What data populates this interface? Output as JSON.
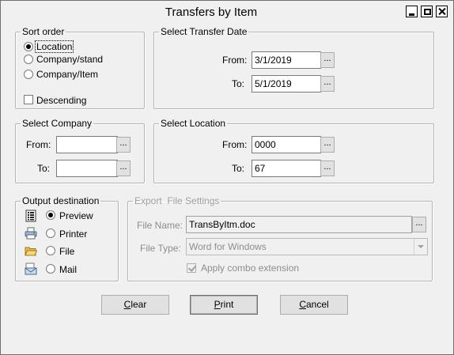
{
  "window": {
    "title": "Transfers by Item",
    "controls": {
      "minimize": "minimize-icon",
      "maximize": "maximize-icon",
      "close": "close-icon"
    }
  },
  "sort_order": {
    "legend": "Sort order",
    "options": [
      {
        "label": "Location",
        "checked": true
      },
      {
        "label": "Company/stand",
        "checked": false
      },
      {
        "label": "Company/Item",
        "checked": false
      }
    ],
    "descending": {
      "label": "Descending",
      "checked": false
    }
  },
  "transfer_date": {
    "legend": "Select Transfer Date",
    "from_label": "From:",
    "from_value": "3/1/2019",
    "to_label": "To:",
    "to_value": "5/1/2019"
  },
  "company": {
    "legend": "Select Company",
    "from_label": "From:",
    "from_value": "",
    "to_label": "To:",
    "to_value": ""
  },
  "location": {
    "legend": "Select Location",
    "from_label": "From:",
    "from_value": "0000",
    "to_label": "To:",
    "to_value": "67"
  },
  "output": {
    "legend": "Output destination",
    "options": [
      {
        "label": "Preview",
        "icon": "preview-icon",
        "checked": true
      },
      {
        "label": "Printer",
        "icon": "printer-icon",
        "checked": false
      },
      {
        "label": "File",
        "icon": "folder-icon",
        "checked": false
      },
      {
        "label": "Mail",
        "icon": "mail-icon",
        "checked": false
      }
    ]
  },
  "export": {
    "legend": "Export  File Settings",
    "file_name_label": "File Name:",
    "file_name_value": "TransByItm.doc",
    "file_type_label": "File Type:",
    "file_type_value": "Word for Windows",
    "combo_label": "Apply combo extension",
    "combo_checked": true
  },
  "ellipsis": "...",
  "buttons": {
    "clear_ul": "C",
    "clear_rest": "lear",
    "print_ul": "P",
    "print_rest": "rint",
    "cancel_ul": "C",
    "cancel_rest": "ancel"
  }
}
